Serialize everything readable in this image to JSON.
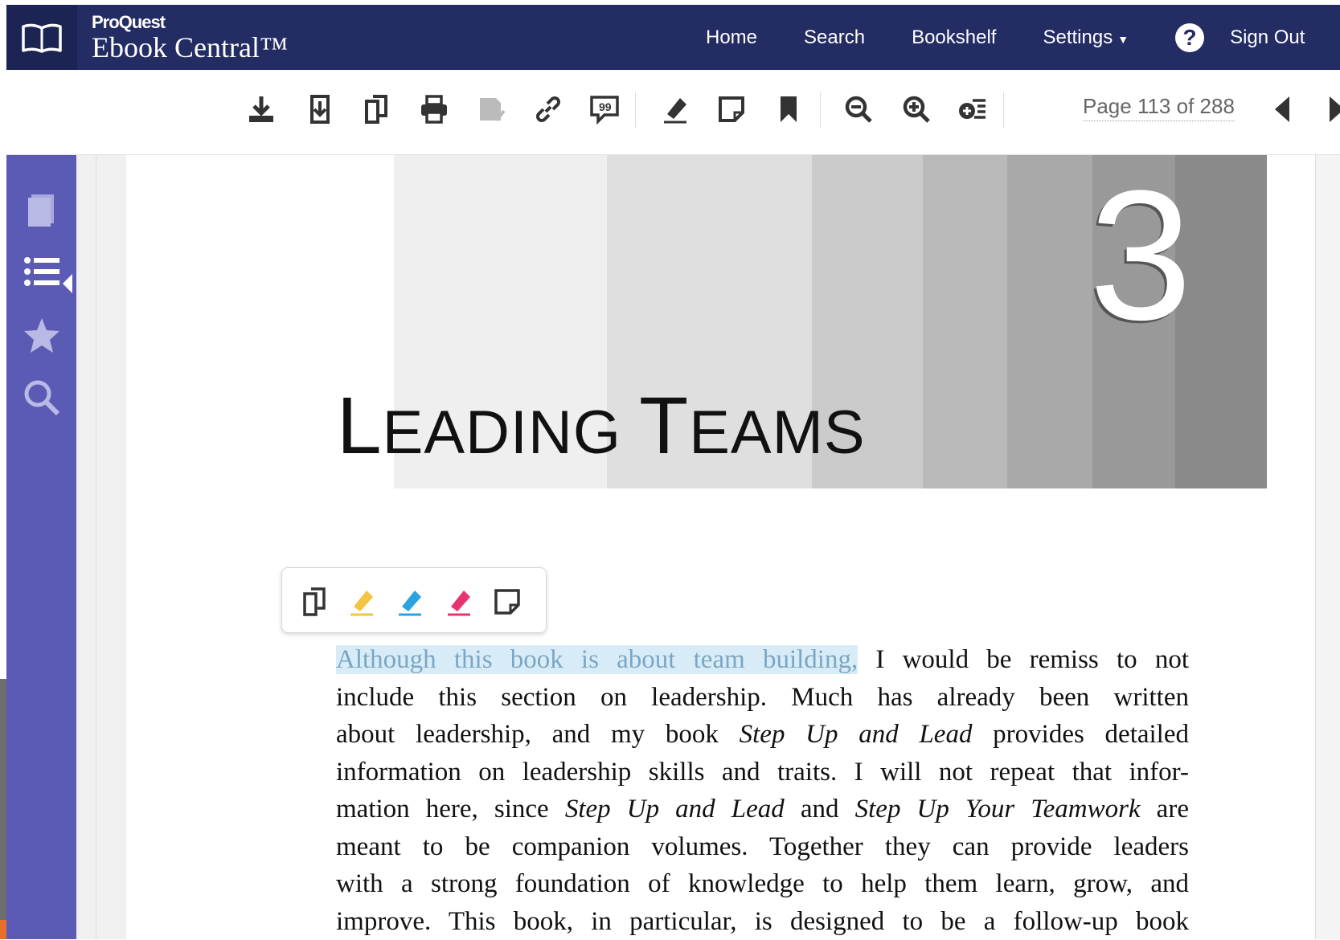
{
  "app": {
    "brand_small": "ProQuest",
    "brand_main": "Ebook Central™"
  },
  "nav": {
    "home": "Home",
    "search": "Search",
    "bookshelf": "Bookshelf",
    "settings": "Settings",
    "help": "?",
    "signout": "Sign Out"
  },
  "toolbar": {
    "icons": [
      "download-icon",
      "download-chapter-icon",
      "copy-icon",
      "print-icon",
      "export-citation-icon",
      "link-icon",
      "cite-icon",
      "highlight-icon",
      "note-icon",
      "bookmark-icon",
      "zoom-out-icon",
      "zoom-in-icon",
      "fit-page-icon"
    ],
    "page_indicator": "Page 113 of 288",
    "prev": "previous-page-icon",
    "next": "next-page-icon"
  },
  "sidebar": {
    "items": [
      "book-icon",
      "table-of-contents-icon",
      "favorites-star-icon",
      "search-icon"
    ]
  },
  "chapter": {
    "number": "3",
    "title_L": "L",
    "title_rest1": "EADING ",
    "title_T": "T",
    "title_rest2": "EAMS"
  },
  "selection_popover": {
    "actions": [
      "copy-icon",
      "highlight-yellow-icon",
      "highlight-blue-icon",
      "highlight-pink-icon",
      "note-icon"
    ],
    "colors": {
      "yellow": "#f4c542",
      "blue": "#2aa3e0",
      "pink": "#e8336f"
    }
  },
  "body": {
    "highlighted": "Although this book is about team building,",
    "line1_rest": " I would be remiss to not",
    "line2": "include this section on leadership. Much has already been written",
    "line3_a": "about leadership, and my book ",
    "line3_i": "Step Up and Lead",
    "line3_b": " provides detailed",
    "line4": "information on leadership skills and traits. I will not repeat that infor-",
    "line5_a": "mation here, since ",
    "line5_i1": "Step Up and Lead",
    "line5_b": " and ",
    "line5_i2": "Step Up Your Teamwork",
    "line5_c": " are",
    "line6": "meant to be companion volumes. Together they can provide leaders",
    "line7": "with a strong foundation of knowledge to help them learn, grow, and",
    "line8": "improve. This book, in particular, is designed to be a follow-up book"
  },
  "colors": {
    "nav_bg": "#232c63",
    "sidebar_bg": "#5b5bb5",
    "highlight_bg": "#d8ecf8"
  }
}
